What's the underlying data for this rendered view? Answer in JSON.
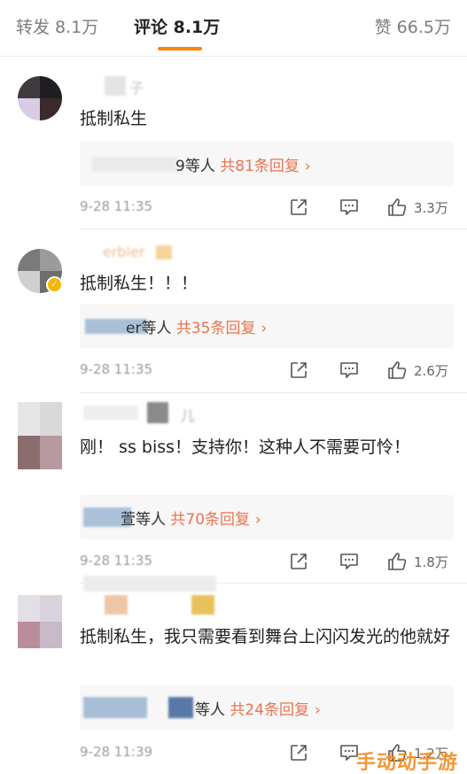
{
  "tabs": {
    "repost": "转发 8.1万",
    "comments": "评论 8.1万",
    "likes": "赞 66.5万"
  },
  "colors": {
    "accent": "#ff8200",
    "reply_link": "#eb7350",
    "verified_badge": "#f5b700"
  },
  "icons": [
    "share-icon",
    "comment-icon",
    "thumbs-up-icon",
    "chevron-right-icon",
    "verified-badge-icon"
  ],
  "comments": [
    {
      "username": "子",
      "text": "抵制私生",
      "reply_prefix": "9等人",
      "reply_count": "共81条回复",
      "time": "9-28 11:35",
      "likes": "3.3万"
    },
    {
      "username": "erbler",
      "text": "抵制私生！！！",
      "reply_prefix": "er等人",
      "reply_count": "共35条回复",
      "time": "9-28 11:35",
      "likes": "2.6万"
    },
    {
      "username": "儿",
      "text": "刚！ ss biss！支持你！这种人不需要可怜！",
      "reply_prefix": "萱等人",
      "reply_count": "共70条回复",
      "time": "9-28 11:35",
      "likes": "1.8万"
    },
    {
      "username": "",
      "text": "抵制私生，我只需要看到舞台上闪闪发光的他就好",
      "reply_prefix": "等人",
      "reply_count": "共24条回复",
      "time": "9-28 11:39",
      "likes": "1.2万"
    }
  ],
  "chevron": "›",
  "watermark": "手动动手游"
}
